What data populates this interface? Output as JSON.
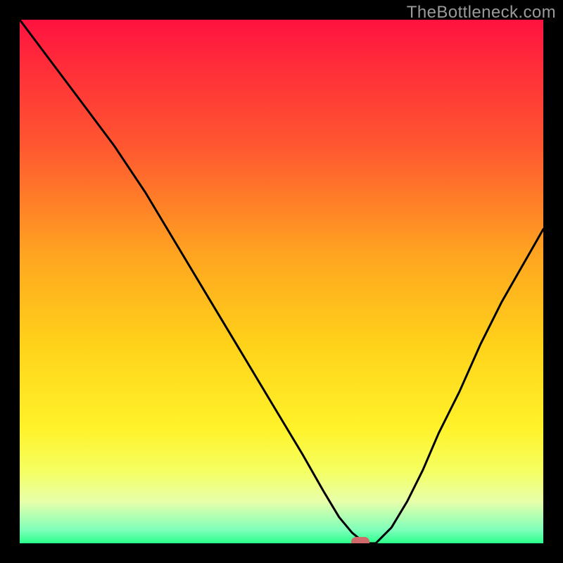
{
  "watermark": "TheBottleneck.com",
  "colors": {
    "frame_bg": "#000000",
    "gradient_top": "#ff1240",
    "gradient_bottom": "#2aff8a",
    "curve": "#000000",
    "marker": "#d06a6a",
    "watermark": "#9a9a9a"
  },
  "chart_data": {
    "type": "line",
    "title": "",
    "xlabel": "",
    "ylabel": "",
    "xlim": [
      0,
      100
    ],
    "ylim": [
      0,
      100
    ],
    "grid": false,
    "legend": false,
    "series": [
      {
        "name": "bottleneck-curve",
        "x": [
          0,
          6,
          12,
          18,
          24,
          30,
          36,
          42,
          48,
          54,
          58,
          61,
          63.5,
          66,
          68,
          71,
          74,
          77,
          80,
          84,
          88,
          92,
          96,
          100
        ],
        "y": [
          100,
          92,
          84,
          76,
          67,
          57,
          47,
          37,
          27,
          17,
          10,
          5,
          2,
          0,
          0,
          3,
          8,
          14,
          21,
          29,
          38,
          46,
          53,
          60
        ]
      }
    ],
    "marker": {
      "x": 65,
      "y": 0,
      "shape": "rounded-rect"
    },
    "background_gradient": {
      "orientation": "vertical",
      "stops": [
        {
          "pos": 0.0,
          "color": "#ff1240"
        },
        {
          "pos": 0.25,
          "color": "#ff5a30"
        },
        {
          "pos": 0.62,
          "color": "#ffd21a"
        },
        {
          "pos": 0.86,
          "color": "#f5ff60"
        },
        {
          "pos": 0.97,
          "color": "#7dffba"
        },
        {
          "pos": 1.0,
          "color": "#2aff8a"
        }
      ]
    }
  }
}
